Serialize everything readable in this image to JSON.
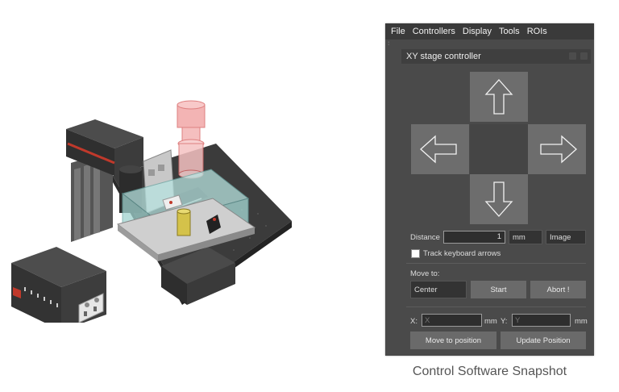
{
  "menu": [
    "File",
    "Controllers",
    "Display",
    "Tools",
    "ROIs"
  ],
  "panel_title": "XY stage controller",
  "arrows": {
    "up": "up-arrow-icon",
    "down": "down-arrow-icon",
    "left": "left-arrow-icon",
    "right": "right-arrow-icon"
  },
  "distance": {
    "label": "Distance",
    "value": "1",
    "unit": "mm",
    "mode": "Image"
  },
  "track_keyboard": {
    "label": "Track keyboard arrows",
    "checked": false
  },
  "move_to": {
    "label": "Move to:",
    "target": "Center",
    "start": "Start",
    "abort": "Abort !"
  },
  "coords": {
    "x_label": "X:",
    "x_placeholder": "X",
    "x_unit": "mm",
    "y_label": "Y:",
    "y_placeholder": "Y",
    "y_unit": "mm"
  },
  "buttons": {
    "move_to_position": "Move to position",
    "update_position": "Update Position"
  },
  "caption": "Control Software Snapshot",
  "colors": {
    "panel_bg": "#4a4a4a",
    "button_bg": "#6a6a6a"
  }
}
